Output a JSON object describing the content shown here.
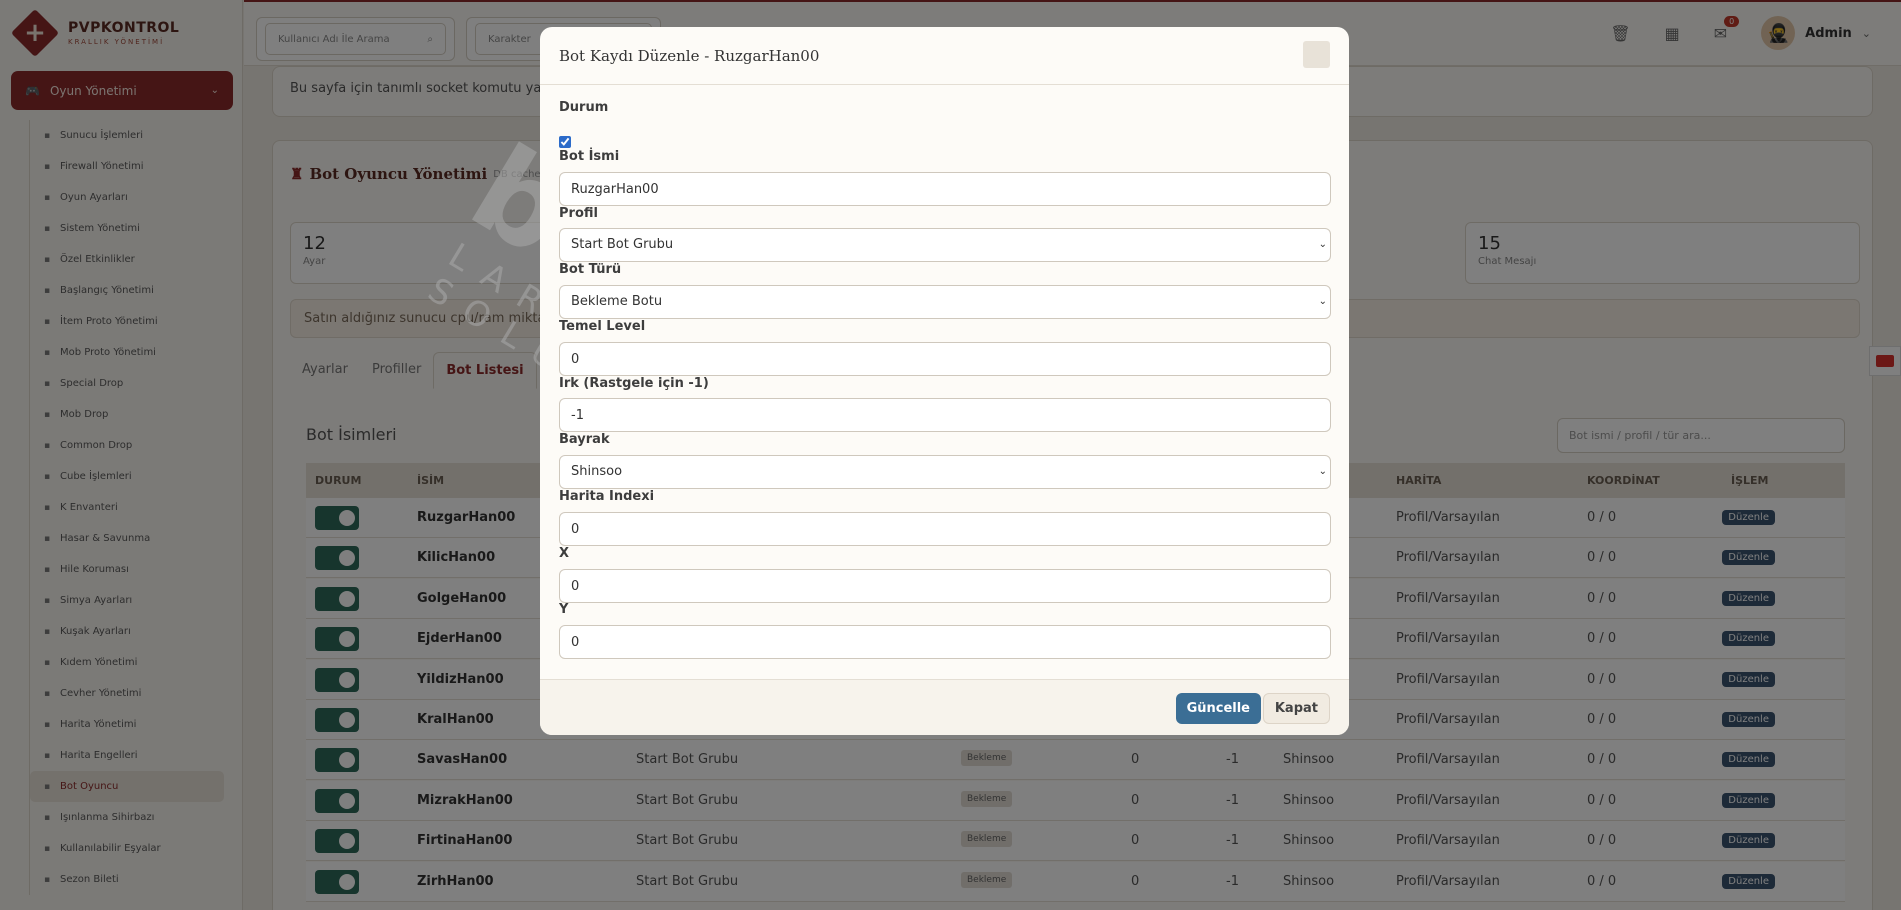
{
  "brand": {
    "title": "PVPKONTROL",
    "subtitle": "KRALLIK YÖNETİMİ"
  },
  "topbar": {
    "search_user_placeholder": "Kullanıcı Adı İle Arama",
    "search_char_placeholder": "Karakter",
    "notification_count": "0",
    "admin_name": "Admin"
  },
  "sidebar": {
    "section_label": "Oyun Yönetimi",
    "items": [
      {
        "label": "Sunucu İşlemleri",
        "icon": "server-icon"
      },
      {
        "label": "Firewall Yönetimi",
        "icon": "shield-icon"
      },
      {
        "label": "Oyun Ayarları",
        "icon": "gears-icon"
      },
      {
        "label": "Sistem Yönetimi",
        "icon": "toggle-icon"
      },
      {
        "label": "Özel Etkinlikler",
        "icon": "list-icon"
      },
      {
        "label": "Başlangıç Yönetimi",
        "icon": "rocket-icon"
      },
      {
        "label": "İtem Proto Yönetimi",
        "icon": "cube-icon"
      },
      {
        "label": "Mob Proto Yönetimi",
        "icon": "paw-icon"
      },
      {
        "label": "Special Drop",
        "icon": "gift-icon"
      },
      {
        "label": "Mob Drop",
        "icon": "box-icon"
      },
      {
        "label": "Common Drop",
        "icon": "table-icon"
      },
      {
        "label": "Cube İşlemleri",
        "icon": "cube-icon"
      },
      {
        "label": "K Envanteri",
        "icon": "grid-icon"
      },
      {
        "label": "Hasar & Savunma",
        "icon": "balance-icon"
      },
      {
        "label": "Hile Koruması",
        "icon": "shield-icon"
      },
      {
        "label": "Simya Ayarları",
        "icon": "gem-icon"
      },
      {
        "label": "Kuşak Ayarları",
        "icon": "belt-icon"
      },
      {
        "label": "Kıdem Yönetimi",
        "icon": "star-icon"
      },
      {
        "label": "Cevher Yönetimi",
        "icon": "gem-icon"
      },
      {
        "label": "Harita Yönetimi",
        "icon": "map-icon"
      },
      {
        "label": "Harita Engelleri",
        "icon": "ban-icon"
      },
      {
        "label": "Bot Oyuncu",
        "icon": "robot-icon",
        "active": true
      },
      {
        "label": "Işınlanma Sihirbazı",
        "icon": "wand-icon"
      },
      {
        "label": "Kullanılabilir Eşyalar",
        "icon": "bag-icon"
      },
      {
        "label": "Sezon Bileti",
        "icon": "trophy-icon"
      }
    ]
  },
  "main": {
    "info_text": "Bu sayfa için tanımlı socket komutu yalnız",
    "section_title": "Bot Oyuncu Yönetimi",
    "section_note": "DB cache t",
    "stats": [
      {
        "value": "12",
        "label": "Ayar"
      },
      {
        "value": "15",
        "label": "Chat Mesajı"
      }
    ],
    "notice": "Satın aldığınız sunucu cpu/ram miktarın",
    "tabs": [
      "Ayarlar",
      "Profiller",
      "Bot Listesi"
    ],
    "active_tab": "Bot Listesi",
    "list_title": "Bot İsimleri",
    "list_search_placeholder": "Bot ismi / profil / tür ara...",
    "columns": [
      "DURUM",
      "İSİM",
      "HARİTA",
      "KOORDİNAT",
      "İŞLEM"
    ],
    "edit_label": "Düzenle",
    "rows": [
      {
        "name": "RuzgarHan00",
        "profile": "",
        "type": "",
        "level": "",
        "race": "",
        "flag": "",
        "map": "Profil/Varsayılan",
        "coord": "0 / 0"
      },
      {
        "name": "KilicHan00",
        "profile": "",
        "type": "",
        "level": "",
        "race": "",
        "flag": "",
        "map": "Profil/Varsayılan",
        "coord": "0 / 0"
      },
      {
        "name": "GolgeHan00",
        "profile": "",
        "type": "",
        "level": "",
        "race": "",
        "flag": "",
        "map": "Profil/Varsayılan",
        "coord": "0 / 0"
      },
      {
        "name": "EjderHan00",
        "profile": "",
        "type": "",
        "level": "",
        "race": "",
        "flag": "",
        "map": "Profil/Varsayılan",
        "coord": "0 / 0"
      },
      {
        "name": "YildizHan00",
        "profile": "",
        "type": "",
        "level": "",
        "race": "",
        "flag": "",
        "map": "Profil/Varsayılan",
        "coord": "0 / 0"
      },
      {
        "name": "KralHan00",
        "profile": "",
        "type": "",
        "level": "",
        "race": "",
        "flag": "",
        "map": "Profil/Varsayılan",
        "coord": "0 / 0"
      },
      {
        "name": "SavasHan00",
        "profile": "Start Bot Grubu",
        "type": "Bekleme",
        "level": "0",
        "race": "-1",
        "flag": "Shinsoo",
        "map": "Profil/Varsayılan",
        "coord": "0 / 0"
      },
      {
        "name": "MizrakHan00",
        "profile": "Start Bot Grubu",
        "type": "Bekleme",
        "level": "0",
        "race": "-1",
        "flag": "Shinsoo",
        "map": "Profil/Varsayılan",
        "coord": "0 / 0"
      },
      {
        "name": "FirtinaHan00",
        "profile": "Start Bot Grubu",
        "type": "Bekleme",
        "level": "0",
        "race": "-1",
        "flag": "Shinsoo",
        "map": "Profil/Varsayılan",
        "coord": "0 / 0"
      },
      {
        "name": "ZirhHan00",
        "profile": "Start Bot Grubu",
        "type": "Bekleme",
        "level": "0",
        "race": "-1",
        "flag": "Shinsoo",
        "map": "Profil/Varsayılan",
        "coord": "0 / 0"
      }
    ]
  },
  "modal": {
    "title": "Bot Kaydı Düzenle - RuzgarHan00",
    "status_label": "Durum",
    "status_checked": true,
    "name_label": "Bot İsmi",
    "name_value": "RuzgarHan00",
    "profile_label": "Profil",
    "profile_value": "Start Bot Grubu",
    "type_label": "Bot Türü",
    "type_value": "Bekleme Botu",
    "level_label": "Temel Level",
    "level_value": "0",
    "race_label": "Irk (Rastgele için -1)",
    "race_value": "-1",
    "flag_label": "Bayrak",
    "flag_value": "Shinsoo",
    "map_label": "Harita Indexi",
    "map_value": "0",
    "x_label": "X",
    "x_value": "0",
    "y_label": "Y",
    "y_value": "0",
    "update_label": "Güncelle",
    "close_label": "Kapat"
  },
  "watermark": {
    "main": "buyukhosting",
    "sub": "LARGE HOSTING SOLUTIONS"
  }
}
